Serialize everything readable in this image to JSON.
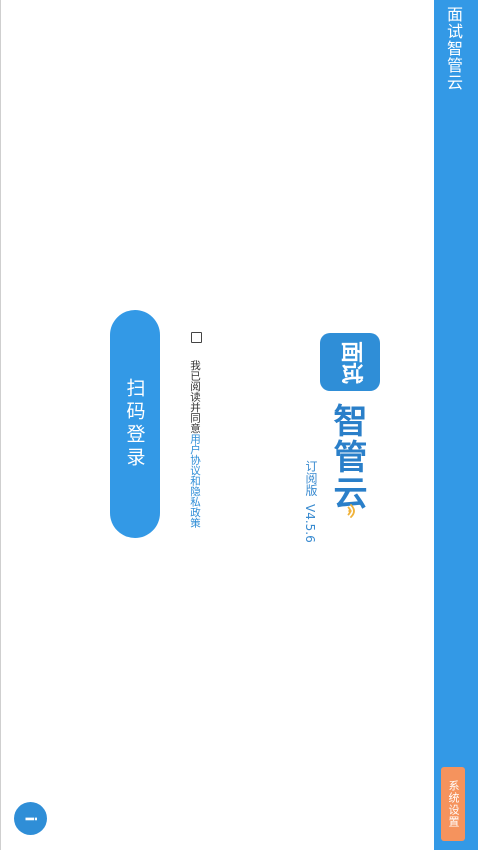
{
  "app_bar": {
    "title": "面试智管云",
    "settings_label": "系统设置"
  },
  "logo": {
    "badge_text": "面试",
    "brand_name": "智管云",
    "edition": "订阅版",
    "version": "V4.5.6"
  },
  "agreement": {
    "checked": false,
    "prefix": "我已阅读并同意",
    "user_agreement": "用户协议",
    "conjunction": "和",
    "privacy_policy": "隐私政策"
  },
  "login": {
    "scan_label": "扫码登录"
  },
  "info_button": {
    "icon": "info-icon",
    "glyph": "i"
  },
  "colors": {
    "primary": "#3399e6",
    "logo_blue": "#2f8ed7",
    "settings_orange": "#f5935d"
  }
}
